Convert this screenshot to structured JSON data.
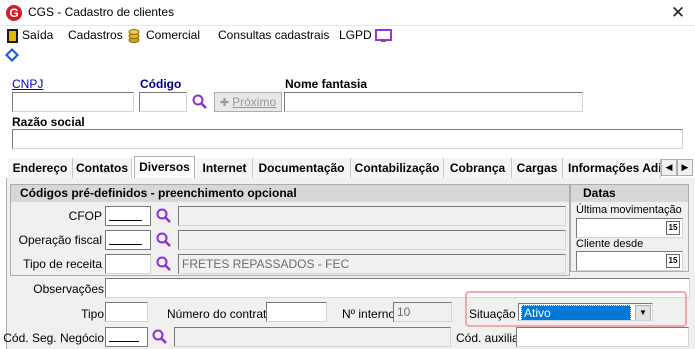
{
  "window": {
    "title": "CGS - Cadastro de clientes",
    "logo_letter": "G",
    "close_glyph": "✕"
  },
  "menu": {
    "items": [
      "Saída",
      "Cadastros",
      "Comercial",
      "Consultas cadastrais",
      "LGPD"
    ]
  },
  "header_form": {
    "cnpj_label": "CNPJ",
    "cnpj_value": "",
    "codigo_label": "Código",
    "codigo_value": "",
    "proximo_label": "Próximo",
    "nome_fantasia_label": "Nome fantasia",
    "nome_fantasia_value": "",
    "razao_social_label": "Razão social",
    "razao_social_value": ""
  },
  "tabs": {
    "items": [
      "Endereço",
      "Contatos",
      "Diversos",
      "Internet",
      "Documentação",
      "Contabilização",
      "Cobrança",
      "Cargas",
      "Informações Adi"
    ],
    "active": "Diversos",
    "scroll_left": "◀",
    "scroll_right": "▶"
  },
  "codigos_group": {
    "title": "Códigos pré-definidos - preenchimento opcional",
    "cfop_label": "CFOP",
    "cfop_desc": "",
    "operacao_label": "Operação fiscal",
    "operacao_desc": "",
    "tipo_receita_label": "Tipo de receita",
    "tipo_receita_desc": "FRETES REPASSADOS - FEC"
  },
  "datas_group": {
    "title": "Datas",
    "ultima_mov_label": "Última movimentação",
    "cliente_desde_label": "Cliente desde",
    "cal_label": "15"
  },
  "bottom_form": {
    "observacoes_label": "Observações",
    "observacoes_value": "",
    "tipo_label": "Tipo",
    "tipo_value": "",
    "numero_contrato_label": "Número do contrato",
    "numero_contrato_value": "",
    "n_interno_label": "Nº interno",
    "n_interno_value": "10",
    "situacao_label": "Situação",
    "situacao_value": "Ativo",
    "cod_seg_label": "Cód. Seg. Negócio",
    "cod_seg_desc": "",
    "cod_auxiliar_label": "Cód. auxiliar",
    "cod_auxiliar_value": ""
  },
  "colors": {
    "accent": "#0000cc",
    "highlight": "#f3a9a9",
    "logo_red": "#d21f26",
    "select_blue": "#0078d7"
  }
}
